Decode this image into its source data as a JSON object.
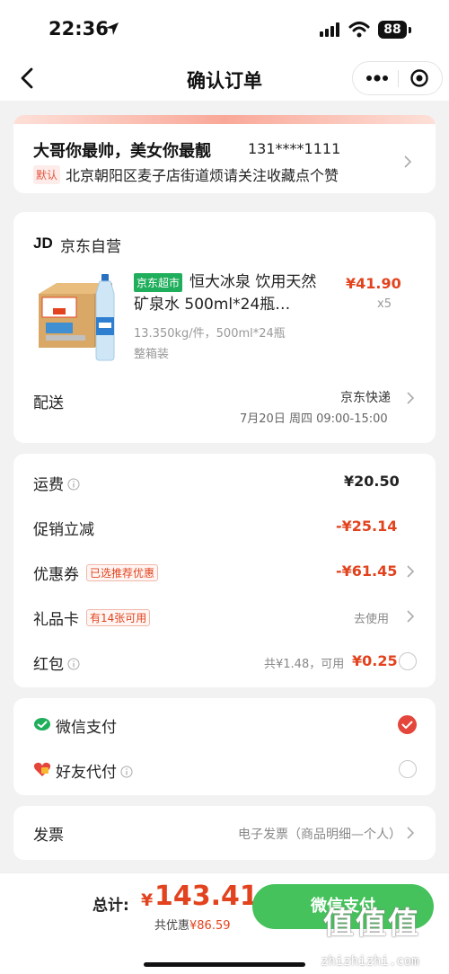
{
  "status_bar": {
    "time": "22:36",
    "battery": "88"
  },
  "nav": {
    "title": "确认订单"
  },
  "address": {
    "name": "大哥你最帅，美女你最靓",
    "phone": "131****1111",
    "default_tag": "默认",
    "detail": "北京朝阳区麦子店街道烦请关注收藏点个赞"
  },
  "shop": {
    "logo": "JD",
    "name": "京东自营"
  },
  "product": {
    "tag": "京东超市",
    "title": "恒大冰泉 饮用天然矿泉水 500ml*24瓶…",
    "price": "¥41.90",
    "quantity": "x5",
    "spec_weight": "13.350kg/件，500ml*24瓶",
    "spec_pack": "整箱装"
  },
  "shipping": {
    "label": "配送",
    "method": "京东快递",
    "time": "7月20日 周四 09:00-15:00"
  },
  "fees": {
    "freight_label": "运费",
    "freight_value": "¥20.50",
    "promo_label": "促销立减",
    "promo_value": "-¥25.14",
    "coupon_label": "优惠券",
    "coupon_badge": "已选推荐优惠",
    "coupon_value": "-¥61.45",
    "giftcard_label": "礼品卡",
    "giftcard_badge": "有14张可用",
    "giftcard_action": "去使用",
    "redpacket_label": "红包",
    "redpacket_total": "共¥1.48，可用",
    "redpacket_value": "¥0.25"
  },
  "payment": {
    "wechat_label": "微信支付",
    "friend_label": "好友代付"
  },
  "invoice": {
    "label": "发票",
    "value": "电子发票（商品明细—个人）"
  },
  "footer": {
    "total_label": "总计:",
    "currency": "¥",
    "total_amount": "143.41",
    "discount_prefix": "共优惠",
    "discount_value": "¥86.59",
    "pay_button": "微信支付"
  },
  "watermark": {
    "logo": "值值值",
    "site": "zhizhizhi.com"
  },
  "colors": {
    "accent_red": "#e2431e",
    "wechat_green": "#45c25b",
    "supermarket_green": "#1fae5b"
  },
  "icons": [
    "location-arrow-icon",
    "signal-icon",
    "wifi-icon",
    "back-arrow-icon",
    "more-dots-icon",
    "close-circle-icon",
    "chevron-right-icon",
    "info-icon",
    "wechat-pay-icon",
    "friend-pay-icon",
    "check-icon"
  ]
}
